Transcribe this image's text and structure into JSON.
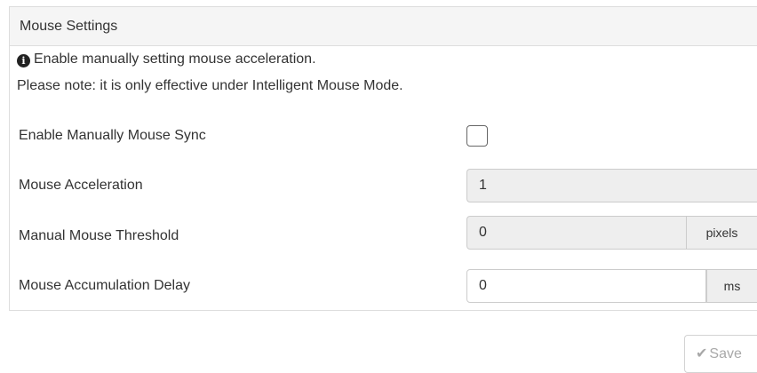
{
  "panel": {
    "title": "Mouse Settings",
    "info_icon": "info-circle-icon",
    "info_line1": "Enable manually setting mouse acceleration.",
    "info_line2": "Please note: it is only effective under Intelligent Mouse Mode."
  },
  "fields": {
    "enable_sync": {
      "label": "Enable Manually Mouse Sync",
      "checked": false
    },
    "acceleration": {
      "label": "Mouse Acceleration",
      "value": "1",
      "disabled": true
    },
    "threshold": {
      "label": "Manual Mouse Threshold",
      "value": "0",
      "unit": "pixels",
      "disabled": true
    },
    "accumulation_delay": {
      "label": "Mouse Accumulation Delay",
      "value": "0",
      "unit": "ms",
      "disabled": false
    }
  },
  "actions": {
    "save_label": "Save",
    "save_icon": "check-icon",
    "save_disabled": true
  }
}
